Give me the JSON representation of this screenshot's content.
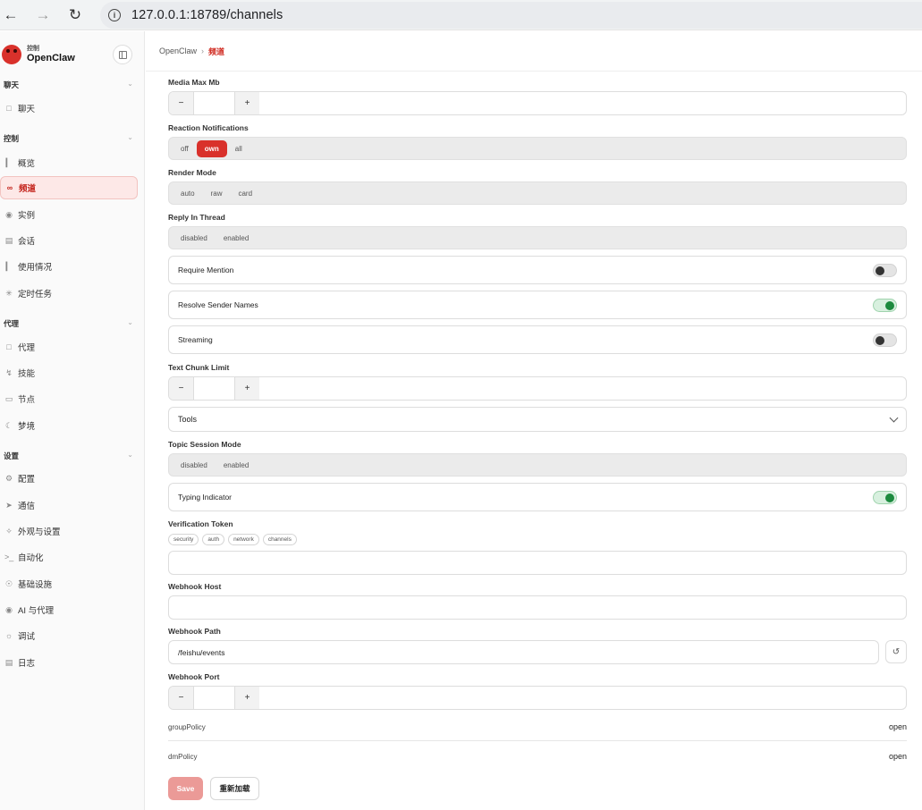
{
  "browser": {
    "url": "127.0.0.1:18789/channels"
  },
  "sidebar": {
    "brand_small": "控制",
    "brand_name": "OpenClaw",
    "groups": [
      {
        "label": "聊天",
        "items": [
          {
            "label": "聊天",
            "icon": "chat-icon"
          }
        ]
      },
      {
        "label": "控制",
        "items": [
          {
            "label": "概览",
            "icon": "bar-chart-icon"
          },
          {
            "label": "频道",
            "icon": "link-icon",
            "active": true
          },
          {
            "label": "实例",
            "icon": "broadcast-icon"
          },
          {
            "label": "会话",
            "icon": "document-icon"
          },
          {
            "label": "使用情况",
            "icon": "bar-chart-icon"
          },
          {
            "label": "定时任务",
            "icon": "loader-icon"
          }
        ]
      },
      {
        "label": "代理",
        "items": [
          {
            "label": "代理",
            "icon": "folder-icon"
          },
          {
            "label": "技能",
            "icon": "zap-icon"
          },
          {
            "label": "节点",
            "icon": "monitor-icon"
          },
          {
            "label": "梦境",
            "icon": "moon-icon"
          }
        ]
      },
      {
        "label": "设置",
        "items": [
          {
            "label": "配置",
            "icon": "gear-icon"
          },
          {
            "label": "通信",
            "icon": "send-icon"
          },
          {
            "label": "外观与设置",
            "icon": "sparkle-icon"
          },
          {
            "label": "自动化",
            "icon": "terminal-icon"
          },
          {
            "label": "基础设施",
            "icon": "globe-icon"
          },
          {
            "label": "AI 与代理",
            "icon": "brain-icon"
          },
          {
            "label": "调试",
            "icon": "bug-icon"
          },
          {
            "label": "日志",
            "icon": "scroll-icon"
          }
        ]
      }
    ]
  },
  "breadcrumb": {
    "root": "OpenClaw",
    "current": "频道"
  },
  "form": {
    "media_max_mb": {
      "label": "Media Max Mb",
      "minus": "−",
      "plus": "+",
      "value": ""
    },
    "reaction_notifications": {
      "label": "Reaction Notifications",
      "options": [
        "off",
        "own",
        "all"
      ],
      "selected": "own"
    },
    "render_mode": {
      "label": "Render Mode",
      "options": [
        "auto",
        "raw",
        "card"
      ],
      "selected": ""
    },
    "reply_in_thread": {
      "label": "Reply In Thread",
      "options": [
        "disabled",
        "enabled"
      ],
      "selected": ""
    },
    "require_mention": {
      "label": "Require Mention",
      "on": false
    },
    "resolve_sender_names": {
      "label": "Resolve Sender Names",
      "on": true
    },
    "streaming": {
      "label": "Streaming",
      "on": false
    },
    "text_chunk_limit": {
      "label": "Text Chunk Limit",
      "minus": "−",
      "plus": "+",
      "value": ""
    },
    "tools": {
      "label": "Tools"
    },
    "topic_session_mode": {
      "label": "Topic Session Mode",
      "options": [
        "disabled",
        "enabled"
      ],
      "selected": ""
    },
    "typing_indicator": {
      "label": "Typing Indicator",
      "on": true
    },
    "verification_token": {
      "label": "Verification Token",
      "tags": [
        "security",
        "auth",
        "network",
        "channels"
      ],
      "value": ""
    },
    "webhook_host": {
      "label": "Webhook Host",
      "value": ""
    },
    "webhook_path": {
      "label": "Webhook Path",
      "value": "/feishu/events",
      "reset": "↺"
    },
    "webhook_port": {
      "label": "Webhook Port",
      "minus": "−",
      "plus": "+",
      "value": ""
    },
    "group_policy": {
      "key": "groupPolicy",
      "value": "open"
    },
    "dm_policy": {
      "key": "dmPolicy",
      "value": "open"
    }
  },
  "actions": {
    "save": "Save",
    "reload": "重新加载"
  },
  "colors": {
    "accent": "#d9312b",
    "toggle_on": "#1c8a3e"
  }
}
